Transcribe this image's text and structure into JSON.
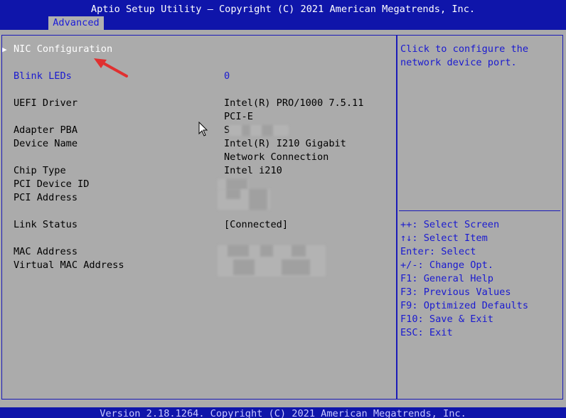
{
  "header": {
    "title": "Aptio Setup Utility – Copyright (C) 2021 American Megatrends, Inc.",
    "tab": "Advanced"
  },
  "menu": {
    "selected_marker": "▶",
    "nic_configuration": "NIC Configuration",
    "blink_leds": {
      "label": "Blink LEDs",
      "value": "0"
    },
    "uefi_driver": {
      "label": "UEFI Driver",
      "value_line1": "Intel(R) PRO/1000 7.5.11",
      "value_line2": "PCI-E"
    },
    "adapter_pba": {
      "label": "Adapter PBA",
      "value_prefix": "S"
    },
    "device_name": {
      "label": "Device Name",
      "value_line1": "Intel(R) I210 Gigabit",
      "value_line2": "Network Connection"
    },
    "chip_type": {
      "label": "Chip Type",
      "value": "Intel i210"
    },
    "pci_device_id": {
      "label": "PCI Device ID"
    },
    "pci_address": {
      "label": "PCI Address"
    },
    "link_status": {
      "label": "Link Status",
      "value": "[Connected]"
    },
    "mac_address": {
      "label": "MAC Address"
    },
    "virtual_mac_address": {
      "label": "Virtual MAC Address"
    }
  },
  "help": {
    "line1": "Click to configure the",
    "line2": "network device port."
  },
  "keys": [
    "++: Select Screen",
    "↑↓: Select Item",
    "Enter: Select",
    "+/-: Change Opt.",
    "F1: General Help",
    "F3: Previous Values",
    "F9: Optimized Defaults",
    "F10: Save & Exit",
    "ESC: Exit"
  ],
  "footer": {
    "version": "Version 2.18.1264. Copyright (C) 2021 American Megatrends, Inc."
  },
  "colors": {
    "bar_blue": "#0f15aa",
    "background_gray": "#ababab",
    "highlight_blue": "#1a1ad0",
    "annotation_red": "#e03030"
  },
  "icons": [
    "right-triangle-icon",
    "annotation-arrow-icon",
    "mouse-cursor-icon"
  ]
}
